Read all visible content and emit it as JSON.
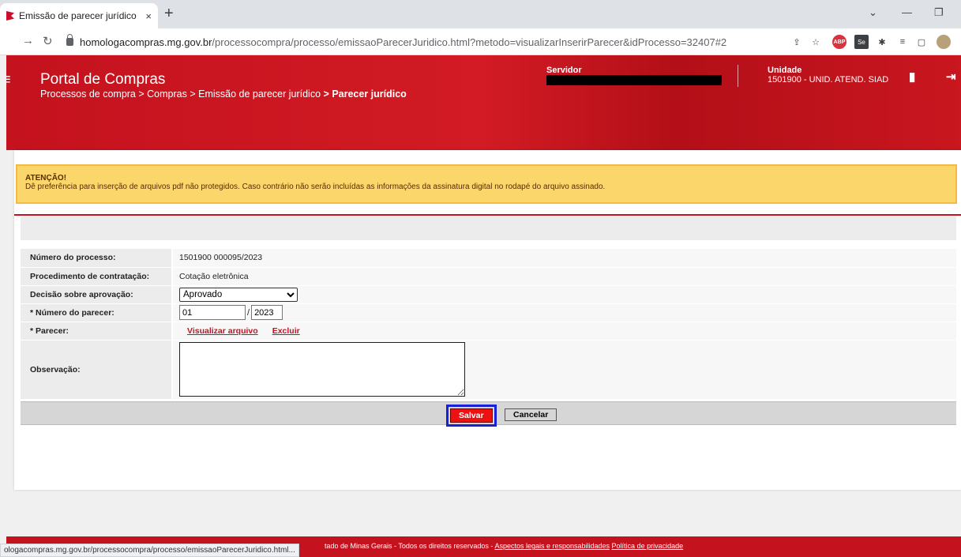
{
  "browser": {
    "tab_title": "Emissão de parecer jurídico",
    "tab_close": "×",
    "new_tab": "+",
    "url_host": "homologacompras.mg.gov.br",
    "url_path": "/processocompra/processo/emissaoParecerJuridico.html?metodo=visualizarInserirParecer&idProcesso=32407#2",
    "ext_abp": "ABP",
    "ext_se": "Se",
    "status_url": "ologacompras.mg.gov.br/processocompra/processo/emissaoParecerJuridico.html..."
  },
  "header": {
    "title": "Portal de Compras",
    "breadcrumb": [
      "Processos de compra",
      "Compras",
      "Emissão de parecer jurídico",
      "Parecer jurídico"
    ],
    "servidor_label": "Servidor",
    "unidade_label": "Unidade",
    "unidade_value": "1501900 - UNID. ATEND. SIAD"
  },
  "alert": {
    "title": "ATENÇÃO!",
    "text": "Dê preferência para inserção de arquivos pdf não protegidos. Caso contrário não serão incluídas as informações da assinatura digital no rodapé do arquivo assinado."
  },
  "form": {
    "numero_processo_label": "Número do processo:",
    "numero_processo_value": "1501900 000095/2023",
    "procedimento_label": "Procedimento de contratação:",
    "procedimento_value": "Cotação eletrônica",
    "decisao_label": "Decisão sobre aprovação:",
    "decisao_value": "Aprovado",
    "numero_parecer_label": "* Número do parecer:",
    "numero_parecer_value": "01",
    "ano_parecer_value": "2023",
    "slash": "/",
    "parecer_label": "* Parecer:",
    "visualizar_link": "Visualizar arquivo",
    "excluir_link": "Excluir",
    "observacao_label": "Observação:"
  },
  "buttons": {
    "save": "Salvar",
    "cancel": "Cancelar"
  },
  "footer": {
    "text": "tado de Minas Gerais - Todos os direitos reservados - ",
    "link_legal": "Aspectos legais e responsabilidades",
    "link_privacy": "Política de privacidade"
  },
  "colors": {
    "brand_red": "#c4121e",
    "alert_yellow": "#fbd66a",
    "highlight_blue": "#1a1fd8"
  }
}
